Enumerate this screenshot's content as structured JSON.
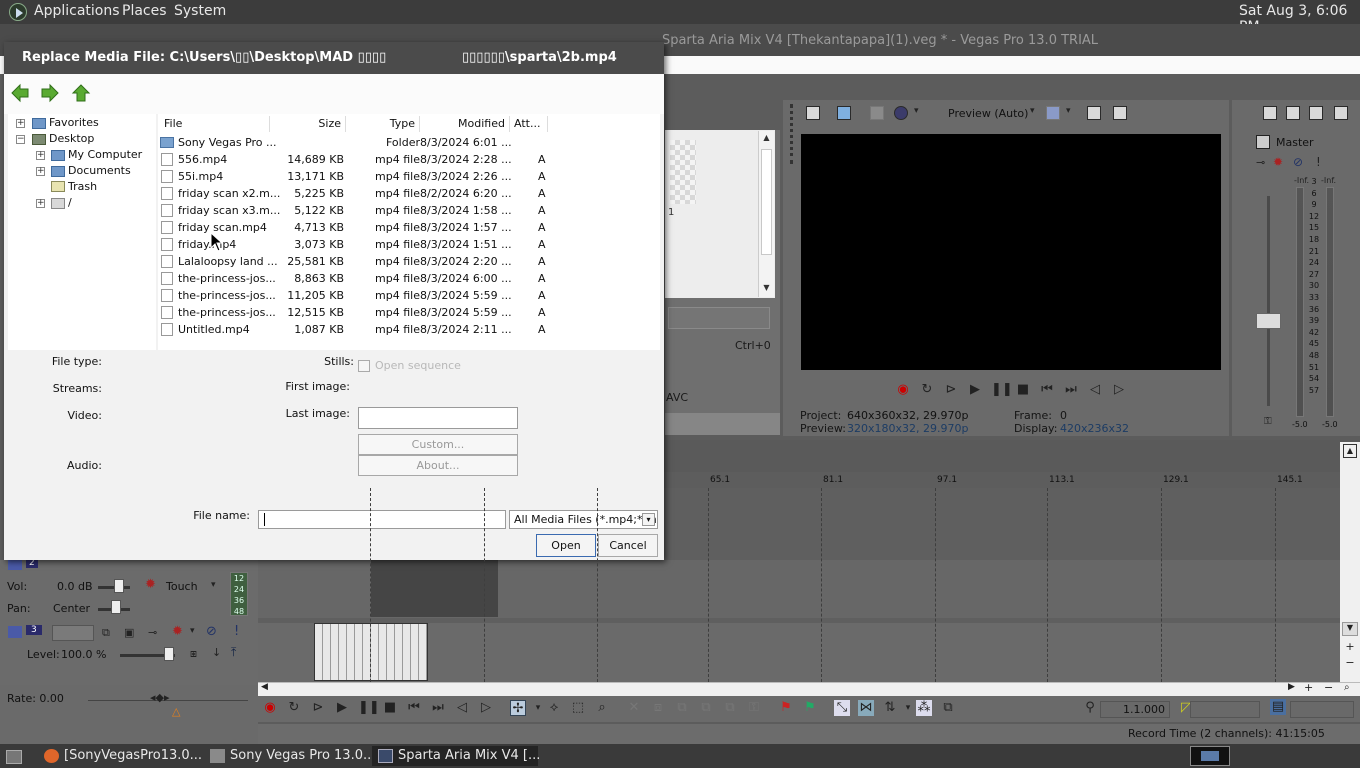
{
  "top_panel": {
    "menus": [
      "Applications",
      "Places",
      "System"
    ],
    "clock": "Sat Aug  3,  6:06 PM"
  },
  "vegas": {
    "window_title": "Sparta Aria Mix V4 [Thekantapapa](1).veg * - Vegas Pro 13.0 TRIAL",
    "explorer": {
      "shortcut_text": "Ctrl+0",
      "codec_text": "AVC",
      "thumb_label": "1"
    },
    "preview": {
      "mode": "Preview (Auto)",
      "project_label": "Project:",
      "project_value": "640x360x32, 29.970p",
      "preview_label": "Preview:",
      "preview_value": "320x180x32, 29.970p",
      "frame_label": "Frame:",
      "frame_value": "0",
      "display_label": "Display:",
      "display_value": "420x236x32"
    },
    "master": {
      "label": "Master",
      "inf_left": "-Inf.",
      "inf_right": "-Inf.",
      "scale": [
        "3",
        "6",
        "9",
        "12",
        "15",
        "18",
        "21",
        "24",
        "27",
        "30",
        "33",
        "36",
        "39",
        "42",
        "45",
        "48",
        "51",
        "54",
        "57"
      ],
      "bottom_left": "-5.0",
      "bottom_right": "-5.0"
    },
    "ruler_ticks": [
      "65.1",
      "81.1",
      "97.1",
      "113.1",
      "129.1",
      "145.1"
    ],
    "track_headers": {
      "video_track_number": "2",
      "vol_label": "Vol:",
      "vol_value": "0.0 dB",
      "touch_label": "Touch",
      "pan_label": "Pan:",
      "pan_value": "Center",
      "meter_values": [
        "12",
        "24",
        "36",
        "48"
      ],
      "audio_track_number": "3",
      "level_label": "Level:",
      "level_value": "100.0 %"
    },
    "rate": "Rate: 0.00",
    "timecode": "1.1.000",
    "record_time": "Record Time (2 channels): 41:15:05"
  },
  "taskbar": {
    "items": [
      {
        "label": "[SonyVegasPro13.0...",
        "icon": "firefox-icon",
        "active": false
      },
      {
        "label": "Sony Vegas Pro 13.0...",
        "icon": "folder-icon",
        "active": false
      },
      {
        "label": "Sparta Aria Mix V4 [...",
        "icon": "vegas-icon",
        "active": true
      }
    ]
  },
  "dialog": {
    "title_left": "Replace Media File: C:\\Users\\▯▯\\Desktop\\MAD ▯▯▯▯",
    "title_right": "▯▯▯▯▯▯\\sparta\\2b.mp4",
    "tree": [
      {
        "label": "Favorites",
        "expander": "+"
      },
      {
        "label": "Desktop",
        "expander": "−"
      },
      {
        "label": "My Computer",
        "expander": "+"
      },
      {
        "label": "Documents",
        "expander": "+"
      },
      {
        "label": "Trash",
        "expander": ""
      },
      {
        "label": "/",
        "expander": "+"
      }
    ],
    "columns": [
      "File",
      "Size",
      "Type",
      "Modified",
      "Att..."
    ],
    "files": [
      {
        "name": "Sony Vegas Pro ...",
        "size": "",
        "type": "Folder",
        "modified": "8/3/2024 6:01 ...",
        "attr": "",
        "folder": true
      },
      {
        "name": "556.mp4",
        "size": "14,689 KB",
        "type": "mp4 file",
        "modified": "8/3/2024 2:28 ...",
        "attr": "A"
      },
      {
        "name": "55i.mp4",
        "size": "13,171 KB",
        "type": "mp4 file",
        "modified": "8/3/2024 2:26 ...",
        "attr": "A"
      },
      {
        "name": "friday scan x2.m...",
        "size": "5,225 KB",
        "type": "mp4 file",
        "modified": "8/2/2024 6:20 ...",
        "attr": "A"
      },
      {
        "name": "friday scan x3.m...",
        "size": "5,122 KB",
        "type": "mp4 file",
        "modified": "8/3/2024 1:58 ...",
        "attr": "A"
      },
      {
        "name": "friday scan.mp4",
        "size": "4,713 KB",
        "type": "mp4 file",
        "modified": "8/3/2024 1:57 ...",
        "attr": "A"
      },
      {
        "name": "friday.mp4",
        "size": "3,073 KB",
        "type": "mp4 file",
        "modified": "8/3/2024 1:51 ...",
        "attr": "A"
      },
      {
        "name": "Lalaloopsy land ...",
        "size": "25,581 KB",
        "type": "mp4 file",
        "modified": "8/3/2024 2:20 ...",
        "attr": "A"
      },
      {
        "name": "the-princess-jos...",
        "size": "8,863 KB",
        "type": "mp4 file",
        "modified": "8/3/2024 6:00 ...",
        "attr": "A"
      },
      {
        "name": "the-princess-jos...",
        "size": "11,205 KB",
        "type": "mp4 file",
        "modified": "8/3/2024 5:59 ...",
        "attr": "A"
      },
      {
        "name": "the-princess-jos...",
        "size": "12,515 KB",
        "type": "mp4 file",
        "modified": "8/3/2024 5:59 ...",
        "attr": "A"
      },
      {
        "name": "Untitled.mp4",
        "size": "1,087 KB",
        "type": "mp4 file",
        "modified": "8/3/2024 2:11 ...",
        "attr": "A"
      }
    ],
    "props": {
      "file_type": "File type:",
      "streams": "Streams:",
      "video": "Video:",
      "audio": "Audio:",
      "stills": "Stills:",
      "open_sequence": "Open sequence",
      "first_image": "First image:",
      "last_image": "Last image:",
      "custom_button": "Custom...",
      "about_button": "About..."
    },
    "file_name_label": "File name:",
    "file_name_value": "",
    "filter": "All Media Files (*.mp4;*.m",
    "open_button": "Open",
    "cancel_button": "Cancel"
  },
  "colors": {
    "panel": "#3c3c3c",
    "titlebar": "#4b4b4b",
    "dialog_bg": "#f2f2f2",
    "nav_arrow_green": "#4a9a2a",
    "record_red": "#cc0000"
  }
}
